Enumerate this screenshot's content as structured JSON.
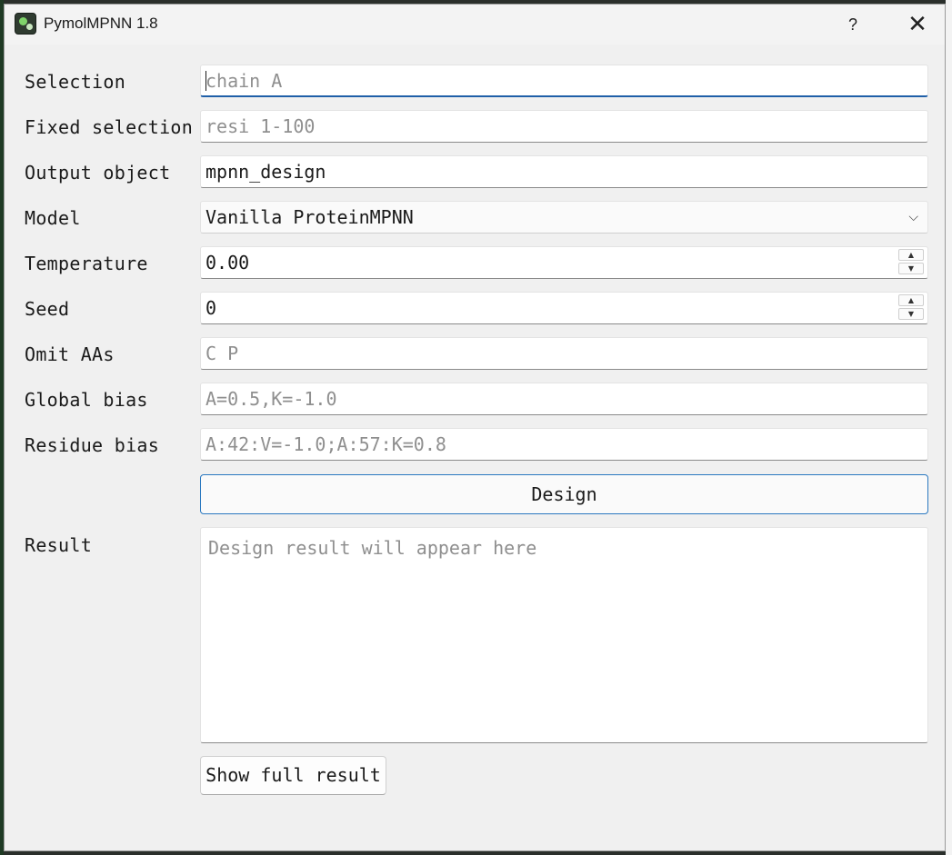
{
  "window": {
    "title": "PymolMPNN 1.8",
    "help_label": "?",
    "close_label": "✕"
  },
  "form": {
    "selection": {
      "label": "Selection",
      "value": "",
      "placeholder": "chain A"
    },
    "fixed_selection": {
      "label": "Fixed selection",
      "value": "",
      "placeholder": "resi 1-100"
    },
    "output_object": {
      "label": "Output object",
      "value": "mpnn_design",
      "placeholder": ""
    },
    "model": {
      "label": "Model",
      "value": "Vanilla ProteinMPNN"
    },
    "temperature": {
      "label": "Temperature",
      "value": "0.00"
    },
    "seed": {
      "label": "Seed",
      "value": "0"
    },
    "omit_aas": {
      "label": "Omit AAs",
      "value": "",
      "placeholder": "C P"
    },
    "global_bias": {
      "label": "Global bias",
      "value": "",
      "placeholder": "A=0.5,K=-1.0"
    },
    "residue_bias": {
      "label": "Residue bias",
      "value": "",
      "placeholder": "A:42:V=-1.0;A:57:K=0.8"
    }
  },
  "design_button": "Design",
  "result": {
    "label": "Result",
    "placeholder": "Design result will appear here"
  },
  "show_full_result_button": "Show full result",
  "icons": {
    "spin_up": "▲",
    "spin_down": "▼",
    "dropdown": "⌵"
  }
}
